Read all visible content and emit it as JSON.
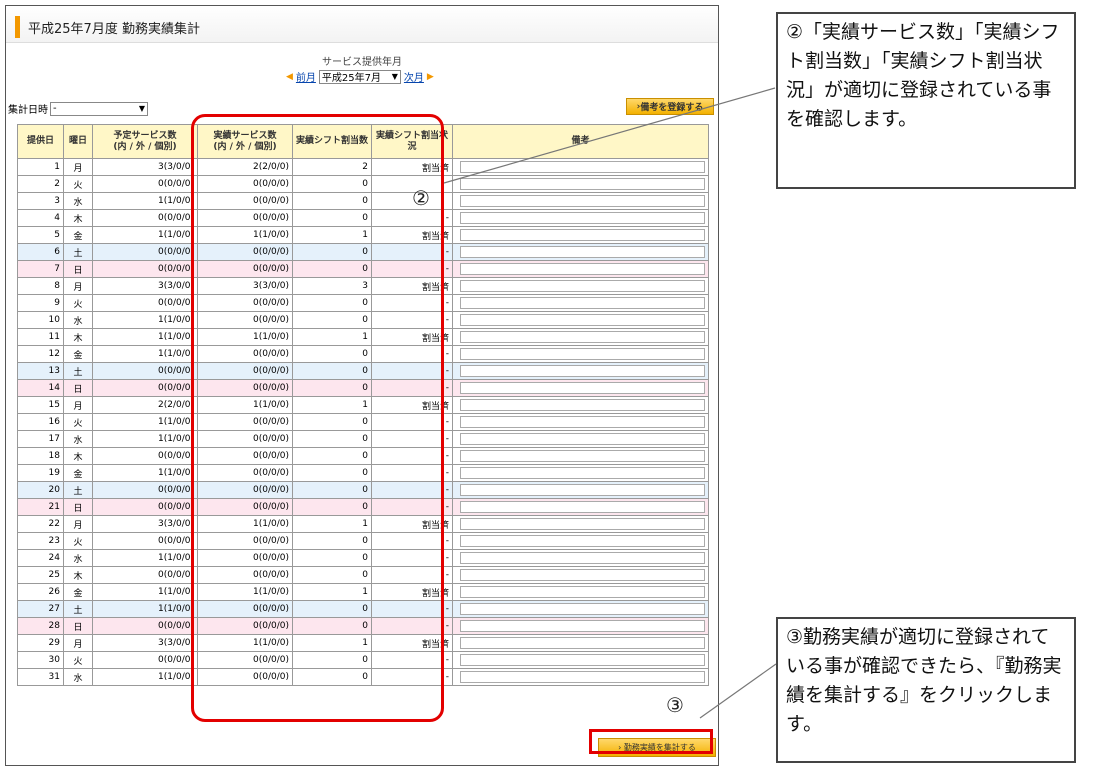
{
  "page_title": "平成25年7月度 勤務実績集計",
  "period": {
    "label": "サービス提供年月",
    "prev": "前月",
    "current": "平成25年7月",
    "next": "次月"
  },
  "aggregate": {
    "label": "集計日時",
    "value": "-"
  },
  "buttons": {
    "register_note": "備考を登録する",
    "aggregate": "勤務実績を集計する"
  },
  "table": {
    "headers": {
      "day": "提供日",
      "weekday": "曜日",
      "planned": "予定サービス数",
      "planned_sub": "(内 / 外 / 個別)",
      "actual": "実績サービス数",
      "actual_sub": "(内 / 外 / 個別)",
      "shift_count": "実績シフト割当数",
      "shift_status": "実績シフト割当状況",
      "note": "備考"
    },
    "rows": [
      {
        "day": "1",
        "wd": "月",
        "planned": "3(3/0/0)",
        "actual": "2(2/0/0)",
        "count": "2",
        "status": "割当済"
      },
      {
        "day": "2",
        "wd": "火",
        "planned": "0(0/0/0)",
        "actual": "0(0/0/0)",
        "count": "0",
        "status": ""
      },
      {
        "day": "3",
        "wd": "水",
        "planned": "1(1/0/0)",
        "actual": "0(0/0/0)",
        "count": "0",
        "status": ""
      },
      {
        "day": "4",
        "wd": "木",
        "planned": "0(0/0/0)",
        "actual": "0(0/0/0)",
        "count": "0",
        "status": "-"
      },
      {
        "day": "5",
        "wd": "金",
        "planned": "1(1/0/0)",
        "actual": "1(1/0/0)",
        "count": "1",
        "status": "割当済"
      },
      {
        "day": "6",
        "wd": "土",
        "planned": "0(0/0/0)",
        "actual": "0(0/0/0)",
        "count": "0",
        "status": "-"
      },
      {
        "day": "7",
        "wd": "日",
        "planned": "0(0/0/0)",
        "actual": "0(0/0/0)",
        "count": "0",
        "status": "-"
      },
      {
        "day": "8",
        "wd": "月",
        "planned": "3(3/0/0)",
        "actual": "3(3/0/0)",
        "count": "3",
        "status": "割当済"
      },
      {
        "day": "9",
        "wd": "火",
        "planned": "0(0/0/0)",
        "actual": "0(0/0/0)",
        "count": "0",
        "status": "-"
      },
      {
        "day": "10",
        "wd": "水",
        "planned": "1(1/0/0)",
        "actual": "0(0/0/0)",
        "count": "0",
        "status": "-"
      },
      {
        "day": "11",
        "wd": "木",
        "planned": "1(1/0/0)",
        "actual": "1(1/0/0)",
        "count": "1",
        "status": "割当済"
      },
      {
        "day": "12",
        "wd": "金",
        "planned": "1(1/0/0)",
        "actual": "0(0/0/0)",
        "count": "0",
        "status": "-"
      },
      {
        "day": "13",
        "wd": "土",
        "planned": "0(0/0/0)",
        "actual": "0(0/0/0)",
        "count": "0",
        "status": "-"
      },
      {
        "day": "14",
        "wd": "日",
        "planned": "0(0/0/0)",
        "actual": "0(0/0/0)",
        "count": "0",
        "status": "-"
      },
      {
        "day": "15",
        "wd": "月",
        "planned": "2(2/0/0)",
        "actual": "1(1/0/0)",
        "count": "1",
        "status": "割当済"
      },
      {
        "day": "16",
        "wd": "火",
        "planned": "1(1/0/0)",
        "actual": "0(0/0/0)",
        "count": "0",
        "status": "-"
      },
      {
        "day": "17",
        "wd": "水",
        "planned": "1(1/0/0)",
        "actual": "0(0/0/0)",
        "count": "0",
        "status": "-"
      },
      {
        "day": "18",
        "wd": "木",
        "planned": "0(0/0/0)",
        "actual": "0(0/0/0)",
        "count": "0",
        "status": "-"
      },
      {
        "day": "19",
        "wd": "金",
        "planned": "1(1/0/0)",
        "actual": "0(0/0/0)",
        "count": "0",
        "status": "-"
      },
      {
        "day": "20",
        "wd": "土",
        "planned": "0(0/0/0)",
        "actual": "0(0/0/0)",
        "count": "0",
        "status": "-"
      },
      {
        "day": "21",
        "wd": "日",
        "planned": "0(0/0/0)",
        "actual": "0(0/0/0)",
        "count": "0",
        "status": "-"
      },
      {
        "day": "22",
        "wd": "月",
        "planned": "3(3/0/0)",
        "actual": "1(1/0/0)",
        "count": "1",
        "status": "割当済"
      },
      {
        "day": "23",
        "wd": "火",
        "planned": "0(0/0/0)",
        "actual": "0(0/0/0)",
        "count": "0",
        "status": "-"
      },
      {
        "day": "24",
        "wd": "水",
        "planned": "1(1/0/0)",
        "actual": "0(0/0/0)",
        "count": "0",
        "status": "-"
      },
      {
        "day": "25",
        "wd": "木",
        "planned": "0(0/0/0)",
        "actual": "0(0/0/0)",
        "count": "0",
        "status": "-"
      },
      {
        "day": "26",
        "wd": "金",
        "planned": "1(1/0/0)",
        "actual": "1(1/0/0)",
        "count": "1",
        "status": "割当済"
      },
      {
        "day": "27",
        "wd": "土",
        "planned": "1(1/0/0)",
        "actual": "0(0/0/0)",
        "count": "0",
        "status": "-"
      },
      {
        "day": "28",
        "wd": "日",
        "planned": "0(0/0/0)",
        "actual": "0(0/0/0)",
        "count": "0",
        "status": "-"
      },
      {
        "day": "29",
        "wd": "月",
        "planned": "3(3/0/0)",
        "actual": "1(1/0/0)",
        "count": "1",
        "status": "割当済"
      },
      {
        "day": "30",
        "wd": "火",
        "planned": "0(0/0/0)",
        "actual": "0(0/0/0)",
        "count": "0",
        "status": "-"
      },
      {
        "day": "31",
        "wd": "水",
        "planned": "1(1/0/0)",
        "actual": "0(0/0/0)",
        "count": "0",
        "status": "-"
      }
    ]
  },
  "annotations": {
    "marker2": "②",
    "marker3": "③",
    "callout2": "②「実績サービス数」「実績シフト割当数」「実績シフト割当状況」が適切に登録されている事を確認します。",
    "callout3": "③勤務実績が適切に登録されている事が確認できたら、『勤務実績を集計する』をクリックします。"
  },
  "colors": {
    "accent": "#f39800",
    "highlight": "#e30000",
    "saturday_row": "#e5f1fb",
    "sunday_row": "#fde6ee",
    "header_bg": "#fff7c7"
  }
}
